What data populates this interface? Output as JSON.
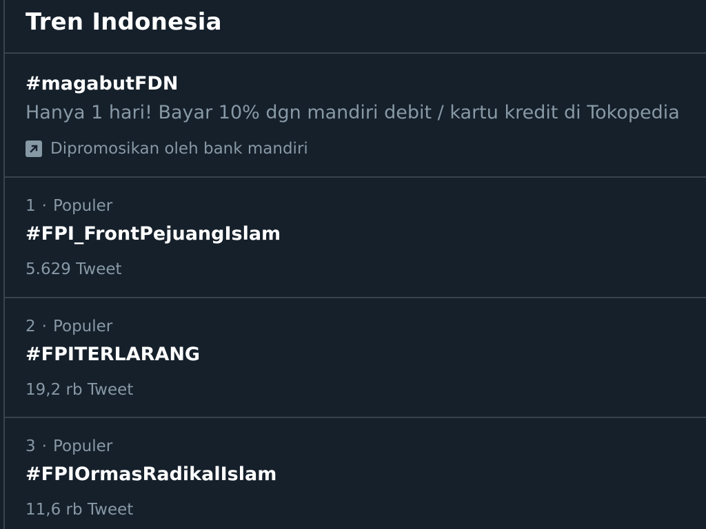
{
  "header": {
    "title": "Tren Indonesia"
  },
  "promoted": {
    "hashtag": "#magabutFDN",
    "description": "Hanya 1 hari! Bayar 10% dgn mandiri debit / kartu kredit di Tokopedia",
    "promoted_by": "Dipromosikan oleh bank mandiri",
    "icon": "promoted-arrow-icon"
  },
  "trends": [
    {
      "rank": "1",
      "separator": "·",
      "category": "Populer",
      "hashtag": "#FPI_FrontPejuangIslam",
      "count": "5.629 Tweet"
    },
    {
      "rank": "2",
      "separator": "·",
      "category": "Populer",
      "hashtag": "#FPITERLARANG",
      "count": "19,2 rb Tweet"
    },
    {
      "rank": "3",
      "separator": "·",
      "category": "Populer",
      "hashtag": "#FPIOrmasRadikalIslam",
      "count": "11,6 rb Tweet"
    }
  ],
  "colors": {
    "background": "#15202b",
    "divider": "#38444d",
    "primary_text": "#ffffff",
    "secondary_text": "#8899a6"
  }
}
